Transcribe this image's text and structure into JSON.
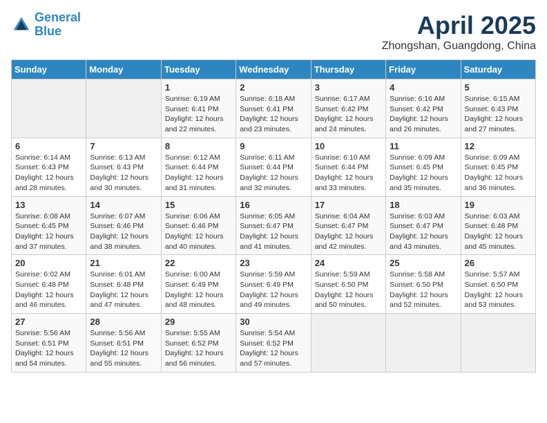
{
  "logo": {
    "line1": "General",
    "line2": "Blue"
  },
  "title": "April 2025",
  "location": "Zhongshan, Guangdong, China",
  "weekdays": [
    "Sunday",
    "Monday",
    "Tuesday",
    "Wednesday",
    "Thursday",
    "Friday",
    "Saturday"
  ],
  "weeks": [
    [
      {
        "day": "",
        "sunrise": "",
        "sunset": "",
        "daylight": ""
      },
      {
        "day": "",
        "sunrise": "",
        "sunset": "",
        "daylight": ""
      },
      {
        "day": "1",
        "sunrise": "Sunrise: 6:19 AM",
        "sunset": "Sunset: 6:41 PM",
        "daylight": "Daylight: 12 hours and 22 minutes."
      },
      {
        "day": "2",
        "sunrise": "Sunrise: 6:18 AM",
        "sunset": "Sunset: 6:41 PM",
        "daylight": "Daylight: 12 hours and 23 minutes."
      },
      {
        "day": "3",
        "sunrise": "Sunrise: 6:17 AM",
        "sunset": "Sunset: 6:42 PM",
        "daylight": "Daylight: 12 hours and 24 minutes."
      },
      {
        "day": "4",
        "sunrise": "Sunrise: 6:16 AM",
        "sunset": "Sunset: 6:42 PM",
        "daylight": "Daylight: 12 hours and 26 minutes."
      },
      {
        "day": "5",
        "sunrise": "Sunrise: 6:15 AM",
        "sunset": "Sunset: 6:43 PM",
        "daylight": "Daylight: 12 hours and 27 minutes."
      }
    ],
    [
      {
        "day": "6",
        "sunrise": "Sunrise: 6:14 AM",
        "sunset": "Sunset: 6:43 PM",
        "daylight": "Daylight: 12 hours and 28 minutes."
      },
      {
        "day": "7",
        "sunrise": "Sunrise: 6:13 AM",
        "sunset": "Sunset: 6:43 PM",
        "daylight": "Daylight: 12 hours and 30 minutes."
      },
      {
        "day": "8",
        "sunrise": "Sunrise: 6:12 AM",
        "sunset": "Sunset: 6:44 PM",
        "daylight": "Daylight: 12 hours and 31 minutes."
      },
      {
        "day": "9",
        "sunrise": "Sunrise: 6:11 AM",
        "sunset": "Sunset: 6:44 PM",
        "daylight": "Daylight: 12 hours and 32 minutes."
      },
      {
        "day": "10",
        "sunrise": "Sunrise: 6:10 AM",
        "sunset": "Sunset: 6:44 PM",
        "daylight": "Daylight: 12 hours and 33 minutes."
      },
      {
        "day": "11",
        "sunrise": "Sunrise: 6:09 AM",
        "sunset": "Sunset: 6:45 PM",
        "daylight": "Daylight: 12 hours and 35 minutes."
      },
      {
        "day": "12",
        "sunrise": "Sunrise: 6:09 AM",
        "sunset": "Sunset: 6:45 PM",
        "daylight": "Daylight: 12 hours and 36 minutes."
      }
    ],
    [
      {
        "day": "13",
        "sunrise": "Sunrise: 6:08 AM",
        "sunset": "Sunset: 6:45 PM",
        "daylight": "Daylight: 12 hours and 37 minutes."
      },
      {
        "day": "14",
        "sunrise": "Sunrise: 6:07 AM",
        "sunset": "Sunset: 6:46 PM",
        "daylight": "Daylight: 12 hours and 38 minutes."
      },
      {
        "day": "15",
        "sunrise": "Sunrise: 6:06 AM",
        "sunset": "Sunset: 6:46 PM",
        "daylight": "Daylight: 12 hours and 40 minutes."
      },
      {
        "day": "16",
        "sunrise": "Sunrise: 6:05 AM",
        "sunset": "Sunset: 6:47 PM",
        "daylight": "Daylight: 12 hours and 41 minutes."
      },
      {
        "day": "17",
        "sunrise": "Sunrise: 6:04 AM",
        "sunset": "Sunset: 6:47 PM",
        "daylight": "Daylight: 12 hours and 42 minutes."
      },
      {
        "day": "18",
        "sunrise": "Sunrise: 6:03 AM",
        "sunset": "Sunset: 6:47 PM",
        "daylight": "Daylight: 12 hours and 43 minutes."
      },
      {
        "day": "19",
        "sunrise": "Sunrise: 6:03 AM",
        "sunset": "Sunset: 6:48 PM",
        "daylight": "Daylight: 12 hours and 45 minutes."
      }
    ],
    [
      {
        "day": "20",
        "sunrise": "Sunrise: 6:02 AM",
        "sunset": "Sunset: 6:48 PM",
        "daylight": "Daylight: 12 hours and 46 minutes."
      },
      {
        "day": "21",
        "sunrise": "Sunrise: 6:01 AM",
        "sunset": "Sunset: 6:48 PM",
        "daylight": "Daylight: 12 hours and 47 minutes."
      },
      {
        "day": "22",
        "sunrise": "Sunrise: 6:00 AM",
        "sunset": "Sunset: 6:49 PM",
        "daylight": "Daylight: 12 hours and 48 minutes."
      },
      {
        "day": "23",
        "sunrise": "Sunrise: 5:59 AM",
        "sunset": "Sunset: 6:49 PM",
        "daylight": "Daylight: 12 hours and 49 minutes."
      },
      {
        "day": "24",
        "sunrise": "Sunrise: 5:59 AM",
        "sunset": "Sunset: 6:50 PM",
        "daylight": "Daylight: 12 hours and 50 minutes."
      },
      {
        "day": "25",
        "sunrise": "Sunrise: 5:58 AM",
        "sunset": "Sunset: 6:50 PM",
        "daylight": "Daylight: 12 hours and 52 minutes."
      },
      {
        "day": "26",
        "sunrise": "Sunrise: 5:57 AM",
        "sunset": "Sunset: 6:50 PM",
        "daylight": "Daylight: 12 hours and 53 minutes."
      }
    ],
    [
      {
        "day": "27",
        "sunrise": "Sunrise: 5:56 AM",
        "sunset": "Sunset: 6:51 PM",
        "daylight": "Daylight: 12 hours and 54 minutes."
      },
      {
        "day": "28",
        "sunrise": "Sunrise: 5:56 AM",
        "sunset": "Sunset: 6:51 PM",
        "daylight": "Daylight: 12 hours and 55 minutes."
      },
      {
        "day": "29",
        "sunrise": "Sunrise: 5:55 AM",
        "sunset": "Sunset: 6:52 PM",
        "daylight": "Daylight: 12 hours and 56 minutes."
      },
      {
        "day": "30",
        "sunrise": "Sunrise: 5:54 AM",
        "sunset": "Sunset: 6:52 PM",
        "daylight": "Daylight: 12 hours and 57 minutes."
      },
      {
        "day": "",
        "sunrise": "",
        "sunset": "",
        "daylight": ""
      },
      {
        "day": "",
        "sunrise": "",
        "sunset": "",
        "daylight": ""
      },
      {
        "day": "",
        "sunrise": "",
        "sunset": "",
        "daylight": ""
      }
    ]
  ]
}
